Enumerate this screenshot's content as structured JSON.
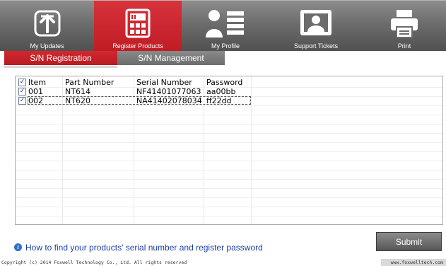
{
  "toolbar": {
    "items": [
      {
        "label": "My Updates",
        "icon": "upload-arrow-icon",
        "active": false
      },
      {
        "label": "Register Products",
        "icon": "calculator-icon",
        "active": true
      },
      {
        "label": "My Profile",
        "icon": "profile-icon",
        "active": false
      },
      {
        "label": "Support Tickets",
        "icon": "support-icon",
        "active": false
      },
      {
        "label": "Print",
        "icon": "printer-icon",
        "active": false
      }
    ],
    "active_color": "#c8232b"
  },
  "tabs": [
    {
      "label": "S/N Registration",
      "active": true
    },
    {
      "label": "S/N Management",
      "active": false
    }
  ],
  "grid": {
    "columns": [
      "Item",
      "Part Number",
      "Serial Number",
      "Password"
    ],
    "header_checked": true,
    "rows": [
      {
        "checked": true,
        "item": "001",
        "part_number": "NT614",
        "serial_number": "NF41401077063",
        "password": "aa00bb"
      },
      {
        "checked": true,
        "item": "002",
        "part_number": "NT620",
        "serial_number": "NA41402078034",
        "password": "ff22dd"
      }
    ]
  },
  "help": {
    "text": "How to find your products' serial number and register password",
    "icon": "info-icon"
  },
  "submit_label": "Submit",
  "footer": {
    "copyright": "Copyright (c) 2014 Foxwell Technology Co., Ltd. All rights reserved",
    "website": "www.foxwelltech.com"
  },
  "colors": {
    "accent_red": "#c8232b",
    "link_blue": "#1a3fa8",
    "toolbar_gray": "#6c6c6c"
  }
}
